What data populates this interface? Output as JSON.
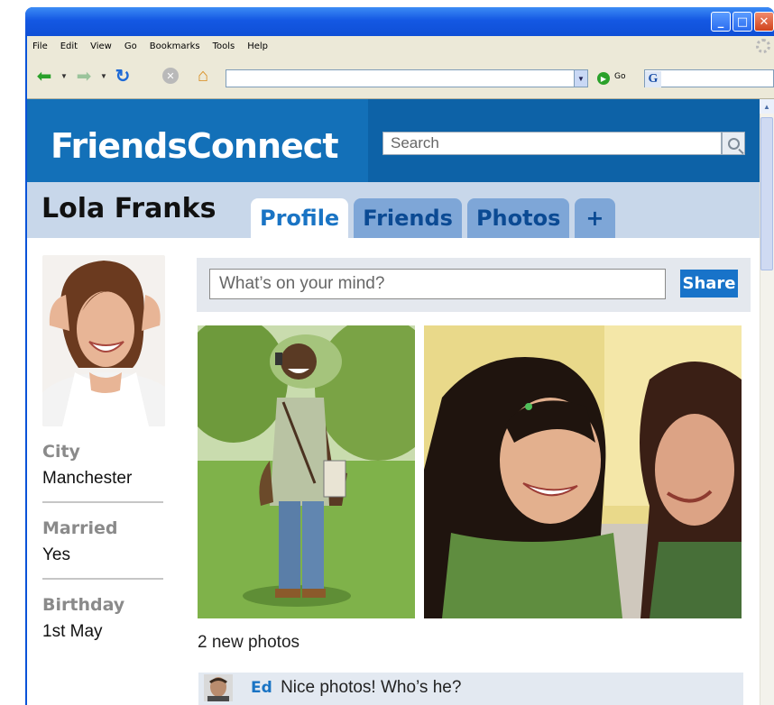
{
  "browser": {
    "menu": [
      "File",
      "Edit",
      "View",
      "Go",
      "Bookmarks",
      "Tools",
      "Help"
    ],
    "go_label": "Go",
    "url": "",
    "window_buttons": [
      "minimize-icon",
      "maximize-icon",
      "close-icon"
    ]
  },
  "site": {
    "name": "FriendsConnect",
    "search_placeholder": "Search",
    "colors": {
      "header": "#1370b8",
      "accent": "#1a74c4",
      "profile_bar": "#c8d7ea"
    }
  },
  "profile": {
    "name": "Lola Franks",
    "tabs": [
      {
        "label": "Profile",
        "active": true
      },
      {
        "label": "Friends",
        "active": false
      },
      {
        "label": "Photos",
        "active": false
      },
      {
        "label": "+",
        "active": false
      }
    ],
    "info": [
      {
        "label": "City",
        "value": "Manchester"
      },
      {
        "label": "Married",
        "value": "Yes"
      },
      {
        "label": "Birthday",
        "value": "1st May"
      }
    ]
  },
  "status": {
    "placeholder": "What’s on your mind?",
    "share_label": "Share"
  },
  "feed": {
    "photos_caption": "2 new photos",
    "comments": [
      {
        "author": "Ed",
        "text": "Nice photos! Who’s he?"
      }
    ]
  }
}
